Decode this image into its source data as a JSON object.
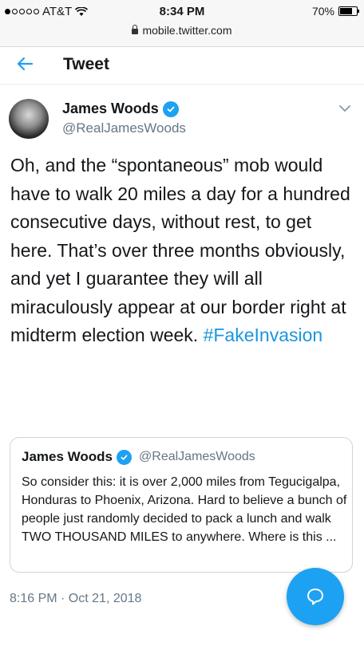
{
  "status_bar": {
    "carrier": "AT&T",
    "time": "8:34 PM",
    "battery": "70%",
    "url": "mobile.twitter.com"
  },
  "header": {
    "title": "Tweet"
  },
  "tweet": {
    "name": "James Woods",
    "handle": "@RealJamesWoods",
    "text": "Oh, and the “spontaneous” mob would have to walk 20 miles a day for a hundred consecutive days, without rest, to get here. That’s over three months obviously, and yet I guarantee they will all miraculously appear at our border right at  midterm election week.",
    "hashtag": "#FakeInvasion",
    "timestamp": "8:16 PM · Oct 21, 2018"
  },
  "quoted_tweet": {
    "name": "James Woods",
    "handle": "@RealJamesWoods",
    "text": "So consider this: it is over 2,000 miles from Tegucigalpa, Honduras to Phoenix, Arizona. Hard to believe a bunch of people just randomly decided to pack a lunch and walk TWO THOUSAND MILES to anywhere. Where is this ..."
  },
  "colors": {
    "accent": "#1da1f2",
    "link": "#1b95e0",
    "secondary_text": "#657786"
  },
  "icons": [
    "lock-icon",
    "wifi-icon",
    "battery-icon",
    "back-arrow-icon",
    "verified-icon",
    "chevron-down-icon",
    "reply-icon"
  ]
}
